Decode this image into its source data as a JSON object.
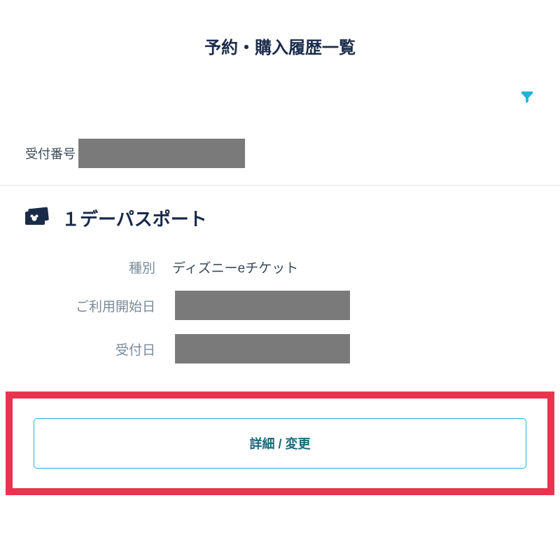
{
  "page": {
    "title": "予約・購入履歴一覧"
  },
  "receipt": {
    "number_label": "受付番号"
  },
  "product": {
    "name": "１デーパスポート"
  },
  "details": {
    "type_label": "種別",
    "type_value": "ディズニーeチケット",
    "start_date_label": "ご利用開始日",
    "receipt_date_label": "受付日"
  },
  "actions": {
    "detail_change_label": "詳細 / 変更"
  },
  "colors": {
    "accent": "#1db4d8",
    "primary_text": "#1a2b4a",
    "highlight_border": "#e8344e"
  }
}
